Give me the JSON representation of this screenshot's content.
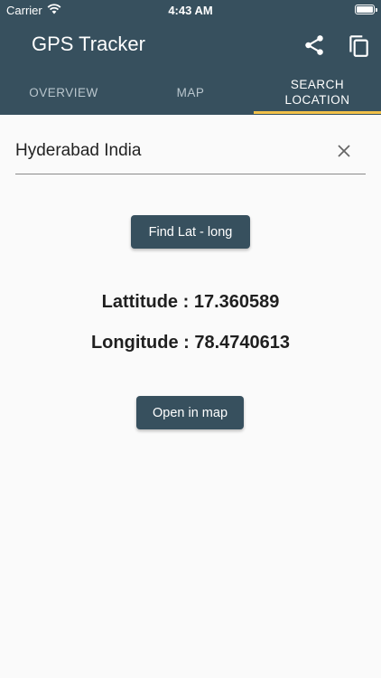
{
  "status_bar": {
    "carrier": "Carrier",
    "time": "4:43 AM"
  },
  "header": {
    "title": "GPS Tracker",
    "actions": [
      "share-icon",
      "copy-icon"
    ]
  },
  "tabs": [
    {
      "label": "OVERVIEW",
      "active": false
    },
    {
      "label": "MAP",
      "active": false
    },
    {
      "label_line1": "SEARCH",
      "label_line2": "LOCATION",
      "active": true
    }
  ],
  "search": {
    "value": "Hyderabad India"
  },
  "buttons": {
    "find": "Find Lat - long",
    "open_map": "Open in map"
  },
  "result": {
    "latitude_label": "Lattitude :",
    "latitude_value": "17.360589",
    "longitude_label": "Longitude :",
    "longitude_value": "78.4740613"
  },
  "colors": {
    "primary": "#37505e",
    "indicator": "#f2c14a",
    "background": "#fafafa"
  }
}
